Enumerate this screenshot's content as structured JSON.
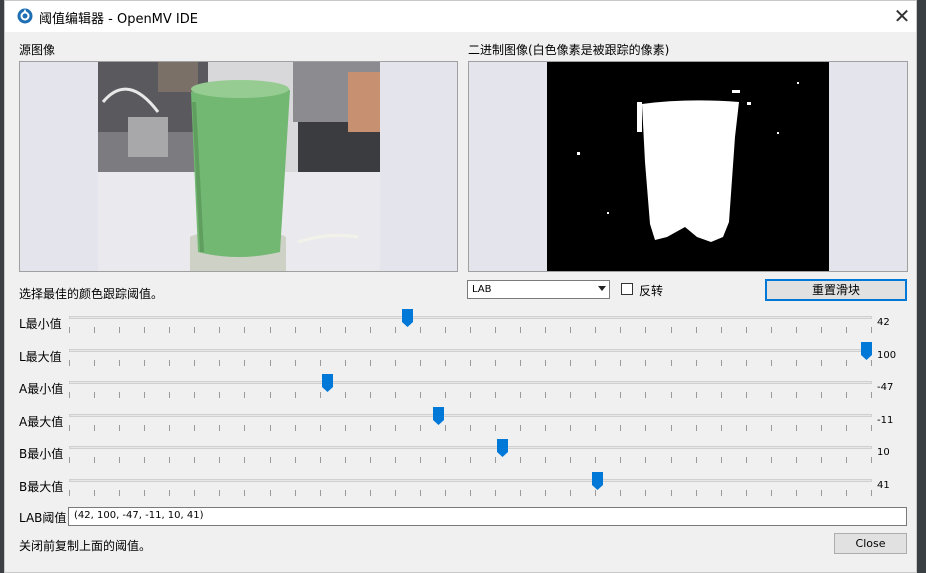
{
  "window": {
    "title": "阈值编辑器 - OpenMV IDE",
    "close_glyph": "✕"
  },
  "source_label": "源图像",
  "binary_label": "二进制图像(白色像素是被跟踪的像素)",
  "instruction": "选择最佳的颜色跟踪阈值。",
  "colorspace": {
    "selected": "LAB"
  },
  "invert_label": "反转",
  "reset_label": "重置滑块",
  "sliders": [
    {
      "label": "L最小值",
      "value": "42",
      "fraction": 0.42
    },
    {
      "label": "L最大值",
      "value": "100",
      "fraction": 1.0
    },
    {
      "label": "A最小值",
      "value": "-47",
      "fraction": 0.32
    },
    {
      "label": "A最大值",
      "value": "-11",
      "fraction": 0.46
    },
    {
      "label": "B最小值",
      "value": "10",
      "fraction": 0.54
    },
    {
      "label": "B最大值",
      "value": "41",
      "fraction": 0.66
    }
  ],
  "lab_threshold": {
    "label": "LAB阈值",
    "value": "(42, 100, -47, -11, 10, 41)"
  },
  "footer_note": "关闭前复制上面的阈值。",
  "close_button": "Close",
  "colors": {
    "accent": "#0078d7",
    "panel": "#e4e4ec",
    "cup_green": "#72b872"
  }
}
